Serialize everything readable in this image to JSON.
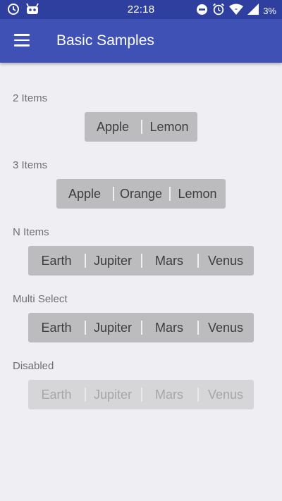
{
  "status_bar": {
    "time": "22:18",
    "battery": "3%",
    "icons": [
      "clock-alarm-icon",
      "android-icon",
      "do-not-disturb-icon",
      "alarm-icon",
      "wifi-icon",
      "cellular-signal-icon"
    ]
  },
  "app_bar": {
    "title": "Basic Samples",
    "menu_icon": "hamburger-menu-icon",
    "color": "#3f51b5"
  },
  "sections": [
    {
      "label": "2 Items",
      "options": [
        "Apple",
        "Lemon"
      ],
      "disabled": false
    },
    {
      "label": "3 Items",
      "options": [
        "Apple",
        "Orange",
        "Lemon"
      ],
      "disabled": false
    },
    {
      "label": "N Items",
      "options": [
        "Earth",
        "Jupiter",
        "Mars",
        "Venus"
      ],
      "disabled": false
    },
    {
      "label": "Multi Select",
      "options": [
        "Earth",
        "Jupiter",
        "Mars",
        "Venus"
      ],
      "disabled": false
    },
    {
      "label": "Disabled",
      "options": [
        "Earth",
        "Jupiter",
        "Mars",
        "Venus"
      ],
      "disabled": true
    }
  ]
}
